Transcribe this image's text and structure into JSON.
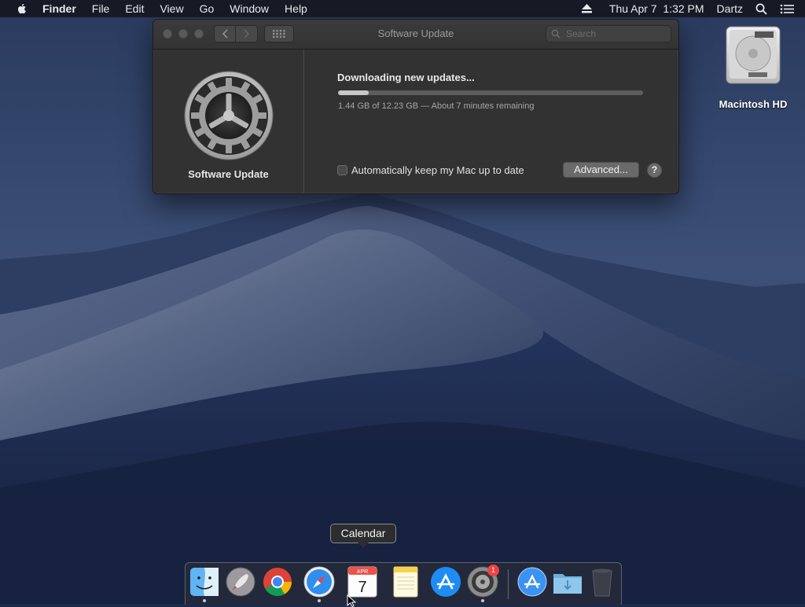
{
  "menubar": {
    "app_name": "Finder",
    "menus": [
      "File",
      "Edit",
      "View",
      "Go",
      "Window",
      "Help"
    ],
    "datetime": "Thu Apr 7  1:32 PM",
    "user": "Dartz"
  },
  "desktop": {
    "icons": [
      {
        "label": "Macintosh HD"
      }
    ]
  },
  "window": {
    "title": "Software Update",
    "search_placeholder": "Search",
    "sidebar_label": "Software Update",
    "download_title": "Downloading new updates...",
    "progress_percent": 10,
    "status_text": "1.44 GB of 12.23 GB — About 7 minutes remaining",
    "auto_update_label": "Automatically keep my Mac up to date",
    "auto_update_checked": false,
    "advanced_button": "Advanced...",
    "help_button": "?"
  },
  "dock": {
    "tooltip": "Calendar",
    "items": [
      {
        "name": "Finder",
        "running": true
      },
      {
        "name": "Launchpad",
        "running": false
      },
      {
        "name": "Google Chrome",
        "running": false
      },
      {
        "name": "Safari",
        "running": true
      },
      {
        "name": "Calendar",
        "running": false,
        "month": "APR",
        "day": "7"
      },
      {
        "name": "Notes",
        "running": false
      },
      {
        "name": "App Store",
        "running": false
      },
      {
        "name": "System Preferences",
        "running": true,
        "badge": "1"
      },
      {
        "name": "Applications",
        "running": false
      },
      {
        "name": "Downloads",
        "running": false
      },
      {
        "name": "Trash",
        "running": false
      }
    ]
  },
  "colors": {
    "menubar_bg": "#14161e",
    "window_bg": "#323232",
    "badge_red": "#f04141"
  },
  "icons": [
    "apple-icon",
    "eject-icon",
    "search-icon",
    "control-center-icon",
    "gear-icon",
    "back-chevron-icon",
    "forward-chevron-icon",
    "grid-icon",
    "hard-drive-icon",
    "cursor-icon"
  ]
}
